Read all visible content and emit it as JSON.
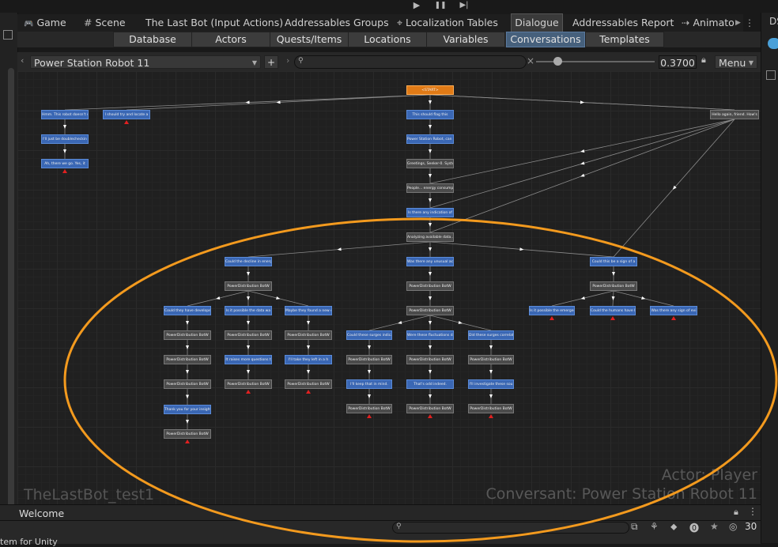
{
  "play_controls": {
    "play": "▶",
    "pause": "❚❚",
    "step": "▶|"
  },
  "tabs": [
    {
      "label": "Game",
      "icon": "gamepad-icon"
    },
    {
      "label": "Scene",
      "icon": "grid-icon"
    },
    {
      "label": "The Last Bot (Input Actions)"
    },
    {
      "label": "Addressables Groups"
    },
    {
      "label": "Localization Tables",
      "icon": "globe-pin-icon"
    },
    {
      "label": "Dialogue",
      "active": true
    },
    {
      "label": "Addressables Report"
    },
    {
      "label": "Animato",
      "icon": "animator-icon"
    }
  ],
  "subtabs": [
    "Database",
    "Actors",
    "Quests/Items",
    "Locations",
    "Variables",
    "Conversations",
    "Templates"
  ],
  "active_subtab": "Conversations",
  "toolbar": {
    "conversation": "Power Station Robot 11",
    "add": "+",
    "search_placeholder": "",
    "clear": "×",
    "zoom": "0.3700",
    "menu": "Menu"
  },
  "nodes": [
    {
      "text": "<START>",
      "kind": "o"
    },
    {
      "text": "Hmm. This robot doesn't s",
      "kind": "b"
    },
    {
      "text": "I should try and locate a",
      "kind": "b"
    },
    {
      "text": "I'll just be doublecheckin",
      "kind": "b"
    },
    {
      "text": "Ah, there we go. Yes, it",
      "kind": "b"
    },
    {
      "text": "This should flag this",
      "kind": "b"
    },
    {
      "text": "Power Station Robot, can y",
      "kind": "b"
    },
    {
      "text": "Greetings, Seeker-0. Syste",
      "kind": "g"
    },
    {
      "text": "People... energy consumpti",
      "kind": "g"
    },
    {
      "text": "Is there any indication of",
      "kind": "b"
    },
    {
      "text": "Analyzing available data...",
      "kind": "g"
    },
    {
      "text": "Hello again, friend. How's",
      "kind": "g"
    },
    {
      "text": "Could the decline in energ",
      "kind": "b"
    },
    {
      "text": "Was there any unusual acti",
      "kind": "b"
    },
    {
      "text": "Could this be a sign of a",
      "kind": "b"
    },
    {
      "text": "PowerDistribution BotW",
      "kind": "g"
    },
    {
      "text": "PowerDistribution BotW",
      "kind": "g"
    },
    {
      "text": "PowerDistribution BotW",
      "kind": "g"
    },
    {
      "text": "PowerDistribution BotW",
      "kind": "g"
    },
    {
      "text": "Could they have develope",
      "kind": "b"
    },
    {
      "text": "Is it possible the data wa",
      "kind": "b"
    },
    {
      "text": "Maybe they found a new ene",
      "kind": "b"
    },
    {
      "text": "Is it possible the emergen",
      "kind": "b"
    },
    {
      "text": "Could the humans have left",
      "kind": "b"
    },
    {
      "text": "Was there any sign of evi",
      "kind": "b"
    },
    {
      "text": "Could these surges indicat",
      "kind": "b"
    },
    {
      "text": "Were these fluctuations da",
      "kind": "b"
    },
    {
      "text": "Did these surges correlate",
      "kind": "b"
    },
    {
      "text": "PowerDistribution BotW",
      "kind": "g"
    },
    {
      "text": "PowerDistribution BotW",
      "kind": "g"
    },
    {
      "text": "PowerDistribution BotW",
      "kind": "g"
    },
    {
      "text": "PowerDistribution BotW",
      "kind": "g"
    },
    {
      "text": "PowerDistribution BotW",
      "kind": "g"
    },
    {
      "text": "PowerDistribution BotW",
      "kind": "g"
    },
    {
      "text": "PowerDistribution BotW",
      "kind": "g"
    },
    {
      "text": "It raises more questions t",
      "kind": "b"
    },
    {
      "text": "I'll take they left in a h",
      "kind": "b"
    },
    {
      "text": "I'll keep that in mind.",
      "kind": "b"
    },
    {
      "text": "That's odd indeed.",
      "kind": "b"
    },
    {
      "text": "I'll investigate these sou",
      "kind": "b"
    },
    {
      "text": "PowerDistribution BotW",
      "kind": "g"
    },
    {
      "text": "PowerDistribution BotW",
      "kind": "g"
    },
    {
      "text": "PowerDistribution BotW",
      "kind": "g"
    },
    {
      "text": "PowerDistribution BotW",
      "kind": "g"
    },
    {
      "text": "PowerDistribution BotW",
      "kind": "g"
    },
    {
      "text": "PowerDistribution BotW",
      "kind": "g"
    },
    {
      "text": "Thank you for your insight",
      "kind": "b"
    },
    {
      "text": "PowerDistribution BotW",
      "kind": "g"
    }
  ],
  "watermark": {
    "database": "TheLastBot_test1",
    "actor": "Actor: Player",
    "conversant": "Conversant: Power Station Robot 11"
  },
  "status": {
    "welcome": "Welcome"
  },
  "console": {
    "count": "30",
    "bottom_text": "tem for Unity"
  },
  "right_rail": {
    "label": "DS"
  },
  "colors": {
    "highlight": "#f39a1e",
    "player_node": "#3a67b4",
    "npc_node": "#4b4b4b",
    "start_node": "#e07a16"
  }
}
